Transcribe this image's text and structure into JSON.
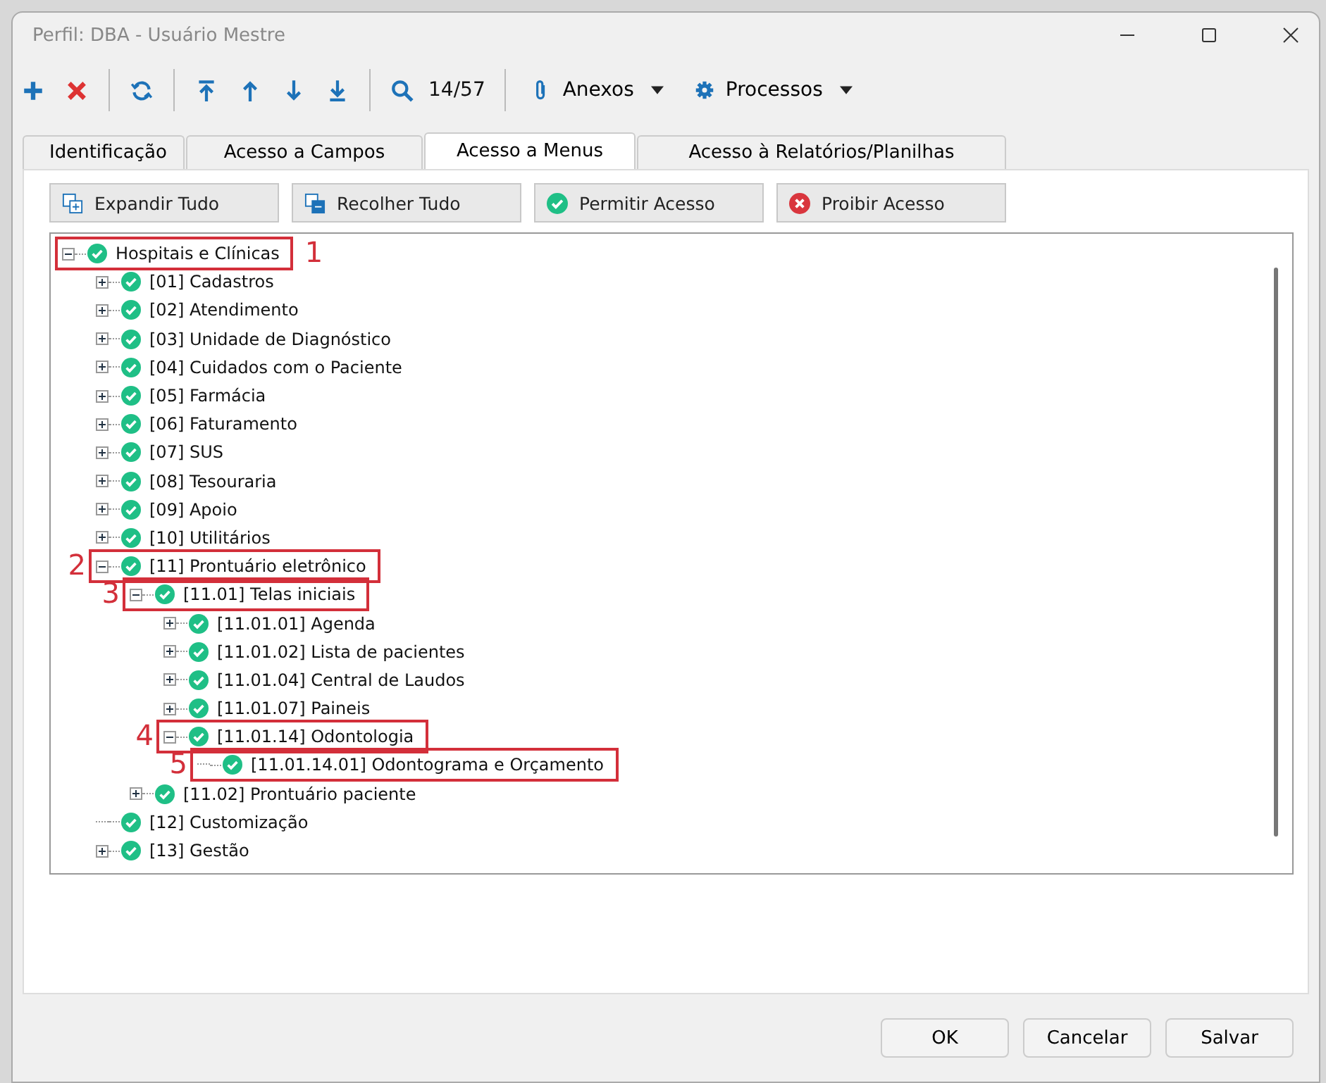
{
  "window": {
    "title": "Perfil: DBA - Usuário Mestre"
  },
  "toolbar": {
    "record_counter": "14/57",
    "menus": [
      {
        "label": "Anexos",
        "kind": "attach"
      },
      {
        "label": "Processos",
        "kind": "process"
      }
    ]
  },
  "tabs": [
    {
      "label": "Identificação",
      "selected": false
    },
    {
      "label": "Acesso a Campos",
      "selected": false
    },
    {
      "label": "Acesso a Menus",
      "selected": true
    },
    {
      "label": "Acesso à Relatórios/Planilhas",
      "selected": false
    }
  ],
  "actions": [
    {
      "label": "Expandir Tudo",
      "kind": "expand"
    },
    {
      "label": "Recolher Tudo",
      "kind": "collapse"
    },
    {
      "label": "Permitir Acesso",
      "kind": "allow"
    },
    {
      "label": "Proibir Acesso",
      "kind": "deny"
    }
  ],
  "tree": [
    {
      "label": "Hospitais e Clínicas",
      "allowed": true,
      "expanded": true,
      "annotation": "1",
      "children": [
        {
          "label": "[01] Cadastros",
          "allowed": true,
          "expanded": false
        },
        {
          "label": "[02] Atendimento",
          "allowed": true,
          "expanded": false
        },
        {
          "label": "[03] Unidade de Diagnóstico",
          "allowed": true,
          "expanded": false
        },
        {
          "label": "[04] Cuidados com o Paciente",
          "allowed": true,
          "expanded": false
        },
        {
          "label": "[05] Farmácia",
          "allowed": true,
          "expanded": false
        },
        {
          "label": "[06] Faturamento",
          "allowed": true,
          "expanded": false
        },
        {
          "label": "[07] SUS",
          "allowed": true,
          "expanded": false
        },
        {
          "label": "[08] Tesouraria",
          "allowed": true,
          "expanded": false
        },
        {
          "label": "[09] Apoio",
          "allowed": true,
          "expanded": false
        },
        {
          "label": "[10] Utilitários",
          "allowed": true,
          "expanded": false
        },
        {
          "label": "[11] Prontuário eletrônico",
          "allowed": true,
          "expanded": true,
          "annotation": "2",
          "children": [
            {
              "label": "[11.01] Telas iniciais",
              "allowed": true,
              "expanded": true,
              "annotation": "3",
              "children": [
                {
                  "label": "[11.01.01] Agenda",
                  "allowed": true,
                  "expanded": false
                },
                {
                  "label": "[11.01.02] Lista de pacientes",
                  "allowed": true,
                  "expanded": false
                },
                {
                  "label": "[11.01.04] Central de Laudos",
                  "allowed": true,
                  "expanded": false
                },
                {
                  "label": "[11.01.07] Paineis",
                  "allowed": true,
                  "expanded": false
                },
                {
                  "label": "[11.01.14] Odontologia",
                  "allowed": true,
                  "expanded": true,
                  "annotation": "4",
                  "children": [
                    {
                      "label": "[11.01.14.01] Odontograma e Orçamento",
                      "allowed": true,
                      "annotation": "5"
                    }
                  ]
                }
              ]
            },
            {
              "label": "[11.02] Prontuário paciente",
              "allowed": true,
              "expanded": false
            }
          ]
        },
        {
          "label": "[12] Customização",
          "allowed": true
        },
        {
          "label": "[13] Gestão",
          "allowed": true,
          "expanded": false
        }
      ]
    }
  ],
  "buttons": [
    {
      "label": "OK"
    },
    {
      "label": "Cancelar"
    },
    {
      "label": "Salvar"
    }
  ]
}
